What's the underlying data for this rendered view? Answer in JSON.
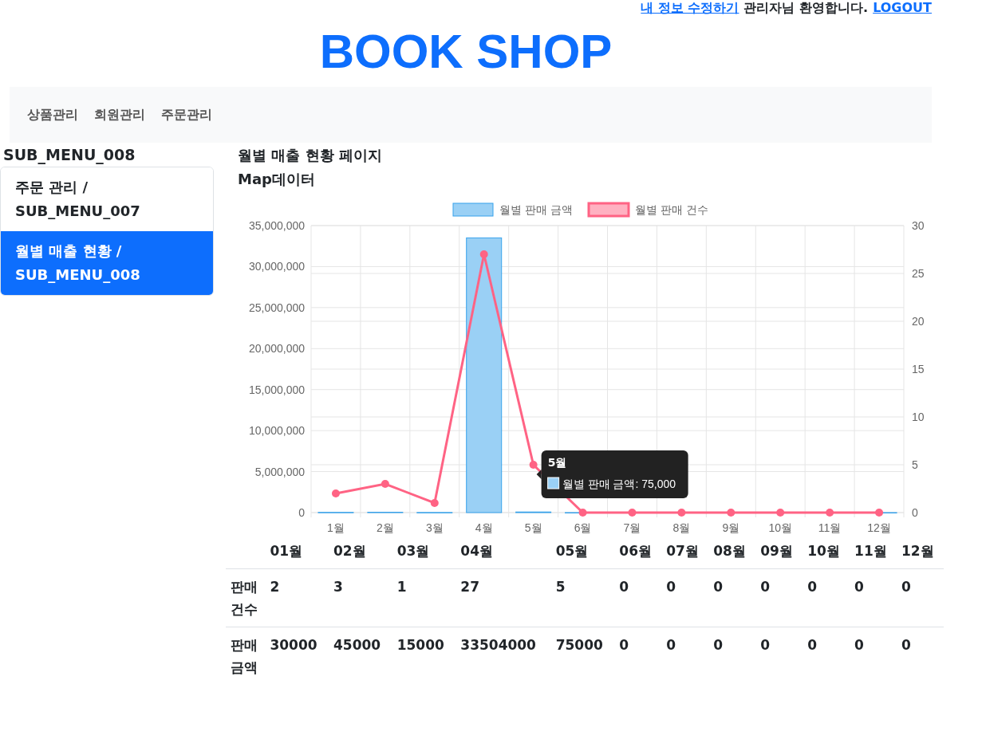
{
  "top_bar": {
    "profile_link": "내 정보 수정하기",
    "welcome": "관리자님 환영합니다.",
    "logout_link": "LOGOUT"
  },
  "title": "BOOK SHOP",
  "nav": [
    {
      "label": "상품관리"
    },
    {
      "label": "회원관리"
    },
    {
      "label": "주문관리"
    }
  ],
  "sidebar": {
    "heading": "SUB_MENU_008",
    "items": [
      {
        "label": "주문 관리 / SUB_MENU_007",
        "selected": false
      },
      {
        "label": "월별 매출 현황 / SUB_MENU_008",
        "selected": true
      }
    ]
  },
  "page_title": "월별 매출 현황 페이지",
  "subtitle": "Map데이터",
  "chart": {
    "chart_data": {
      "type": "bar",
      "categories": [
        "1월",
        "2월",
        "3월",
        "4월",
        "5월",
        "6월",
        "7월",
        "8월",
        "9월",
        "10월",
        "11월",
        "12월"
      ],
      "series": [
        {
          "name": "월별 판매 금액",
          "color": "#9ad0f5",
          "axis": "y",
          "values": [
            30000,
            45000,
            15000,
            33504000,
            75000,
            0,
            0,
            0,
            0,
            0,
            0,
            0
          ]
        },
        {
          "name": "월별 판매 건수",
          "color": "#ff6384",
          "type": "line",
          "axis": "y2",
          "marker": true,
          "values": [
            2,
            3,
            1,
            27,
            5,
            0,
            0,
            0,
            0,
            0,
            0,
            0
          ]
        }
      ],
      "ylim": [
        0,
        35000000
      ],
      "yticks": [
        {
          "value": 0,
          "label": "0"
        },
        {
          "value": 5000000,
          "label": "5,000,000"
        },
        {
          "value": 10000000,
          "label": "10,000,000"
        },
        {
          "value": 15000000,
          "label": "15,000,000"
        },
        {
          "value": 20000000,
          "label": "20,000,000"
        },
        {
          "value": 25000000,
          "label": "25,000,000"
        },
        {
          "value": 30000000,
          "label": "30,000,000"
        },
        {
          "value": 35000000,
          "label": "35,000,000"
        }
      ],
      "grid": true,
      "legend": "top",
      "y2lim": [
        0,
        30
      ],
      "y2ticks": [
        0,
        5,
        10,
        15,
        20,
        25,
        30
      ]
    },
    "tooltip": {
      "title": "5월",
      "text": "월별 판매 금액: 75,000"
    }
  },
  "table": {
    "columns": [
      "01월",
      "02월",
      "03월",
      "04월",
      "05월",
      "06월",
      "07월",
      "08월",
      "09월",
      "10월",
      "11월",
      "12월"
    ],
    "rows": [
      {
        "label": "판매건수",
        "values": [
          "2",
          "3",
          "1",
          "27",
          "5",
          "0",
          "0",
          "0",
          "0",
          "0",
          "0",
          "0"
        ]
      },
      {
        "label": "판매금액",
        "values": [
          "30000",
          "45000",
          "15000",
          "33504000",
          "75000",
          "0",
          "0",
          "0",
          "0",
          "0",
          "0",
          "0"
        ]
      }
    ]
  }
}
